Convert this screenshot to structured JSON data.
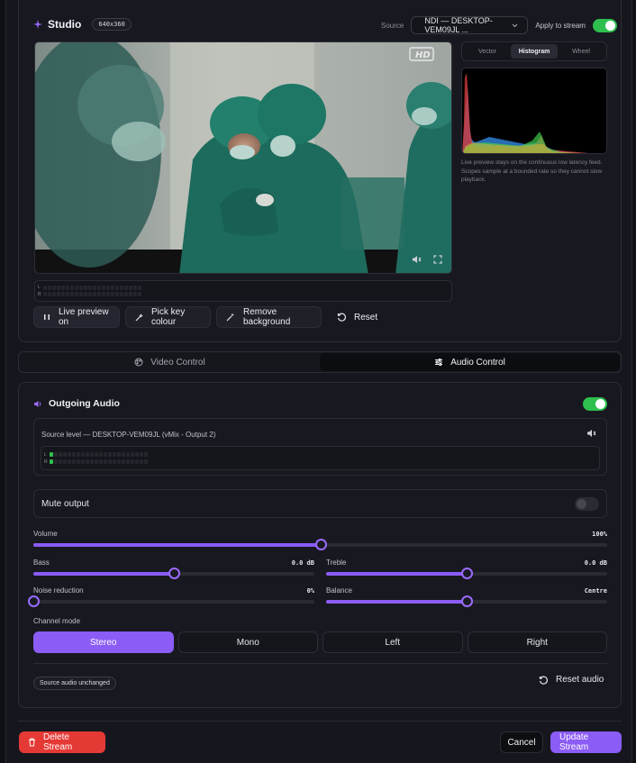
{
  "studio": {
    "title": "Studio",
    "resolution": "640x360",
    "source_label": "Source",
    "source_value": "NDI — DESKTOP-VEM09JL ...",
    "apply_label": "Apply to stream",
    "apply_on": true,
    "hd_badge": "HD",
    "meter_l": "L",
    "meter_r": "R",
    "buttons": {
      "live_preview": "Live preview on",
      "pick_key": "Pick key colour",
      "remove_bg": "Remove background",
      "reset": "Reset"
    },
    "scopes": {
      "tabs": [
        "Vector",
        "Histogram",
        "Wheel"
      ],
      "active": "Histogram",
      "note": "Live preview stays on the continuous low latency feed. Scopes sample at a bounded rate so they cannot slow playback."
    }
  },
  "tabs": {
    "video": "Video Control",
    "audio": "Audio Control",
    "active": "audio"
  },
  "audio": {
    "title": "Outgoing Audio",
    "enabled": true,
    "source_level_label": "Source level — DESKTOP-VEM09JL (vMix - Output 2)",
    "meter_l": "L",
    "meter_r": "R",
    "mute_label": "Mute output",
    "mute_on": false,
    "volume": {
      "label": "Volume",
      "display": "100%",
      "fraction": 0.5
    },
    "bass": {
      "label": "Bass",
      "display": "0.0 dB",
      "fraction": 0.5
    },
    "treble": {
      "label": "Treble",
      "display": "0.0 dB",
      "fraction": 0.5
    },
    "noise": {
      "label": "Noise reduction",
      "display": "0%",
      "fraction": 0.0
    },
    "balance": {
      "label": "Balance",
      "display": "Centre",
      "fraction": 0.5
    },
    "channel_mode_label": "Channel mode",
    "channel_modes": [
      "Stereo",
      "Mono",
      "Left",
      "Right"
    ],
    "channel_active": "Stereo",
    "status_badge": "Source audio unchanged",
    "reset_audio": "Reset audio"
  },
  "footer": {
    "delete": "Delete Stream",
    "cancel": "Cancel",
    "update": "Update Stream"
  },
  "colors": {
    "accent": "#8b5cf6",
    "toggle_on": "#2fbf4f",
    "danger": "#e53935"
  }
}
